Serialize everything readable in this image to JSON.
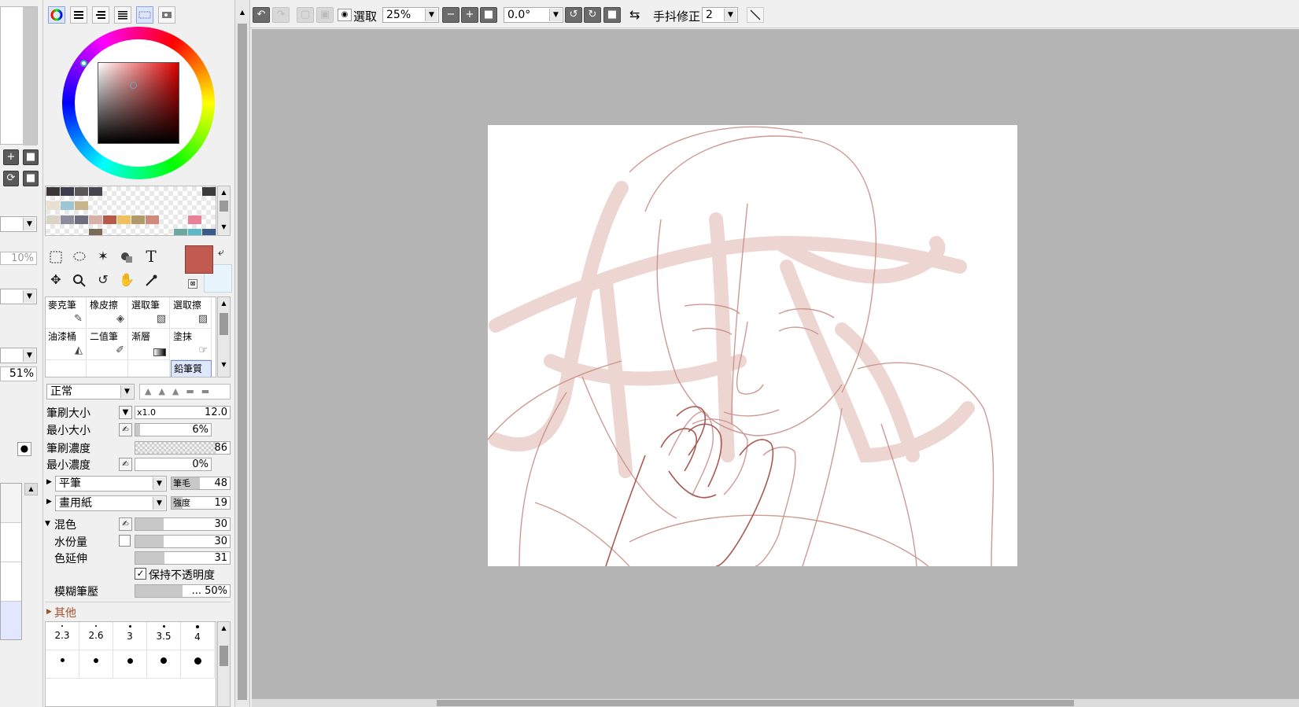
{
  "left_panel": {
    "percent_a": "10%",
    "percent_b": "51%"
  },
  "color_panel": {
    "palette": [
      "#3b3538",
      "#3e3d4f",
      "#5b5658",
      "#46444f",
      "#d9d4c6",
      "#9cc6d3",
      "#c8b48a",
      "#e8e0d0",
      "#8c8c9c",
      "#6e6e80",
      "#d8b0a8",
      "#b85a4a",
      "#f0c060",
      "#b09a6a",
      "#d08a7a",
      "#e8809a",
      "#7a6a5a",
      "#6aa8a0",
      "#4a8aa8",
      "#3a5a8a"
    ],
    "primary_color": "#c15a4f",
    "secondary_color": "#e8f4fb"
  },
  "brushes": [
    {
      "label": "麥克筆",
      "icon": "marker-icon"
    },
    {
      "label": "橡皮擦",
      "icon": "eraser-icon"
    },
    {
      "label": "選取筆",
      "icon": "select-pen-icon"
    },
    {
      "label": "選取擦",
      "icon": "select-eraser-icon"
    },
    {
      "label": "油漆桶",
      "icon": "bucket-icon"
    },
    {
      "label": "二值筆",
      "icon": "binary-pen-icon"
    },
    {
      "label": "漸層",
      "icon": "gradient-icon"
    },
    {
      "label": "塗抹",
      "icon": "smudge-icon"
    },
    {
      "label": "鉛筆質感",
      "icon": "pencil-texture-icon"
    }
  ],
  "brush_settings": {
    "blend_mode": "正常",
    "size_label": "筆刷大小",
    "size_multiplier": "x1.0",
    "size_value": "12.0",
    "min_size_label": "最小大小",
    "min_size_value": "6%",
    "density_label": "筆刷濃度",
    "density_value": "86",
    "min_density_label": "最小濃度",
    "min_density_value": "0%",
    "shape_select": "平筆",
    "bristle_label": "筆毛",
    "bristle_value": "48",
    "texture_select": "畫用紙",
    "strength_label": "強度",
    "strength_value": "19",
    "mix_label": "混色",
    "mix_value": "30",
    "water_label": "水份量",
    "water_value": "30",
    "stretch_label": "色延伸",
    "stretch_value": "31",
    "keep_opacity_label": "保持不透明度",
    "blur_label": "模糊筆壓",
    "blur_value": "... 50%",
    "other_label": "其他"
  },
  "brush_sizes": [
    "2.3",
    "2.6",
    "3",
    "3.5",
    "4"
  ],
  "toolbar": {
    "selection_label": "選取",
    "zoom": "25%",
    "rotation": "0.0°",
    "stabilizer_label": "手抖修正",
    "stabilizer_value": "2"
  },
  "canvas": {
    "bg": "#ffffff",
    "stroke_color": "#c98f88"
  }
}
